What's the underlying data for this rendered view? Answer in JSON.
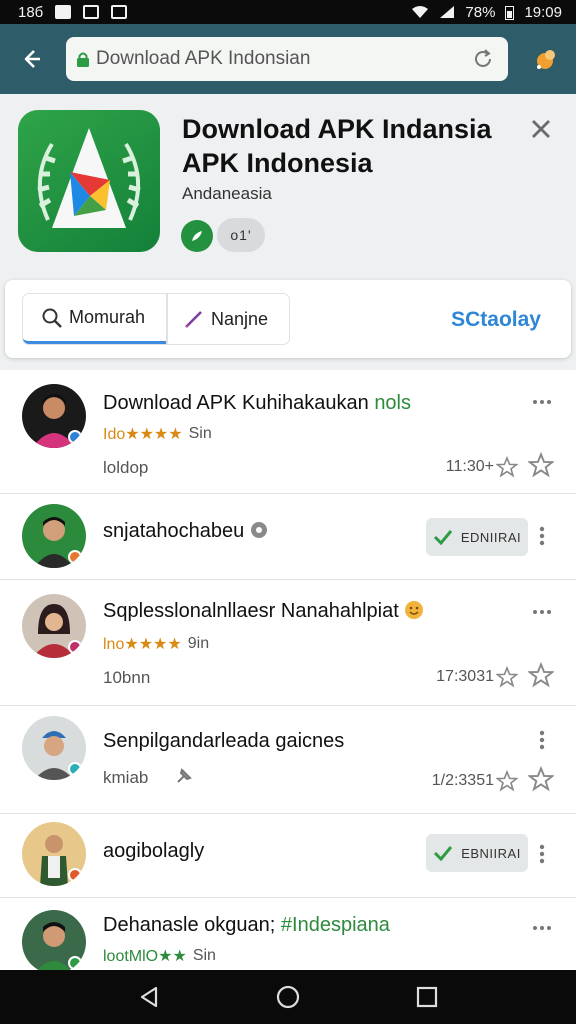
{
  "status_bar": {
    "left_text": "18б",
    "battery": "78%",
    "time": "19:09"
  },
  "toolbar": {
    "url_text": "Download APK Indonsian"
  },
  "app": {
    "title_line1": "Download APK Indansia",
    "title_line2": "APK Indonesia",
    "subtitle": "Andaneasia",
    "pill_text": "o1'"
  },
  "tabs": [
    {
      "label": "Momurah"
    },
    {
      "label": "Nanjne"
    }
  ],
  "tab_link": "SCtaolay",
  "rows": [
    {
      "title": "Download APK Kuhihakaukan",
      "title_tail": "nols",
      "rating": "Ido★★★★",
      "meta_tail": "Sin",
      "sub": "loldop",
      "time": "11:30+",
      "action": ""
    },
    {
      "title": "snjatahochabeu",
      "title_tail": "",
      "rating": "",
      "meta_tail": "",
      "sub": "",
      "time": "",
      "action": "EDNIIRAI"
    },
    {
      "title": "Sqplesslonalnllaesr Nanahahlpiat",
      "title_tail": "",
      "rating": "lno★★★★",
      "meta_tail": "9in",
      "sub": "10bnn",
      "time": "17:3031",
      "action": ""
    },
    {
      "title": "Senpilgandarleada gaicnes",
      "title_tail": "",
      "rating": "",
      "meta_tail": "",
      "sub": "kmiab",
      "time": "1/2:3351",
      "action": ""
    },
    {
      "title": "aogibolagly",
      "title_tail": "",
      "rating": "",
      "meta_tail": "",
      "sub": "",
      "time": "",
      "action": "EBNIIRAI"
    },
    {
      "title": "Dehanasle okguan;",
      "title_tail": "#Indespiana",
      "rating": "lootMlO★★",
      "meta_tail": "Sin",
      "sub": "",
      "time": "",
      "action": ""
    }
  ],
  "colors": {
    "toolbar": "#2e5c68",
    "accent_green": "#23913d",
    "link_blue": "#2d86d6",
    "rating_orange": "#d98a15"
  }
}
